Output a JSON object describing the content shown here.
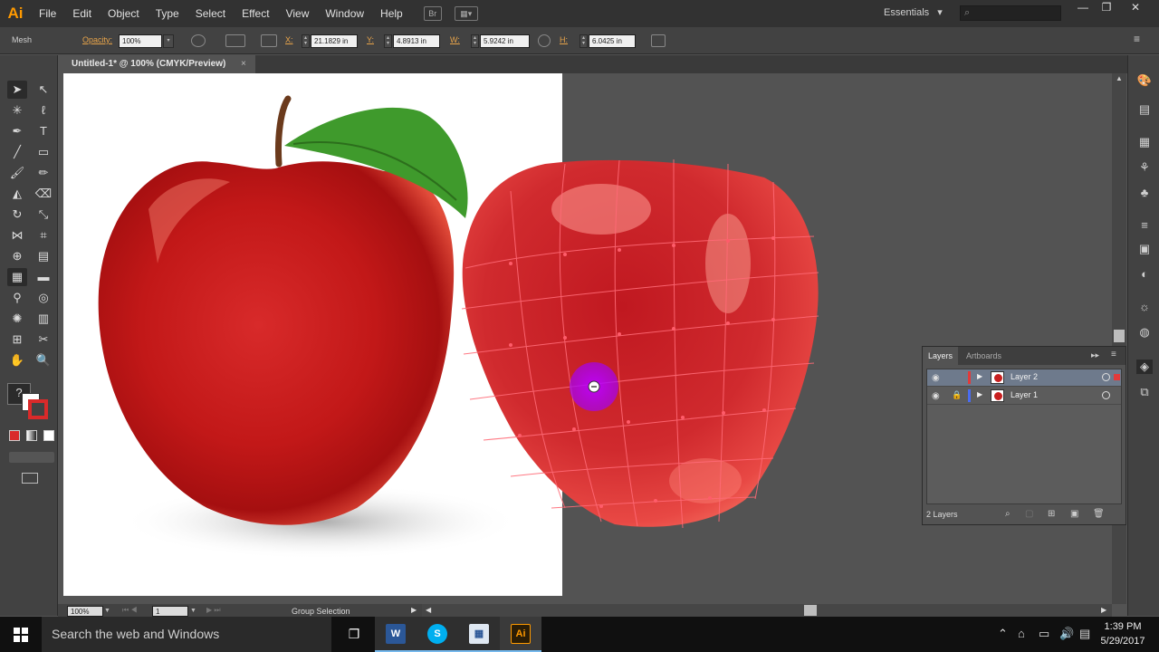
{
  "app": {
    "logo": "Ai"
  },
  "menu": [
    "File",
    "Edit",
    "Object",
    "Type",
    "Select",
    "Effect",
    "View",
    "Window",
    "Help"
  ],
  "menubar_icons": {
    "bridge": "Br"
  },
  "workspace": {
    "label": "Essentials",
    "arrow": "▾"
  },
  "window_controls": {
    "minimize": "—",
    "restore": "❐",
    "close": "✕"
  },
  "control": {
    "tool_name": "Mesh",
    "opacity_label": "Opacity:",
    "opacity_value": "100%",
    "x_label": "X:",
    "x_value": "21.1829 in",
    "y_label": "Y:",
    "y_value": "4.8913 in",
    "w_label": "W:",
    "w_value": "5.9242 in",
    "h_label": "H:",
    "h_value": "6.0425 in"
  },
  "document": {
    "tab_title": "Untitled-1* @ 100% (CMYK/Preview)",
    "close": "×"
  },
  "statusbar": {
    "zoom": "100%",
    "artboard": "1",
    "tool_info": "Group Selection"
  },
  "layers_panel": {
    "tabs": [
      "Layers",
      "Artboards"
    ],
    "layers": [
      {
        "name": "Layer 2",
        "color": "#e23a3a",
        "selected": true
      },
      {
        "name": "Layer 1",
        "color": "#4a6cf0",
        "selected": false
      }
    ],
    "footer": "2 Layers"
  },
  "taskbar": {
    "search_placeholder": "Search the web and Windows",
    "time": "1:39 PM",
    "date": "5/29/2017",
    "apps": [
      "Word",
      "Skype",
      "Photos",
      "Ai"
    ]
  },
  "colors": {
    "accent_orange": "#ff9a00",
    "mesh_line": "#ff5c6a",
    "cursor_highlight": "#a000ff"
  }
}
